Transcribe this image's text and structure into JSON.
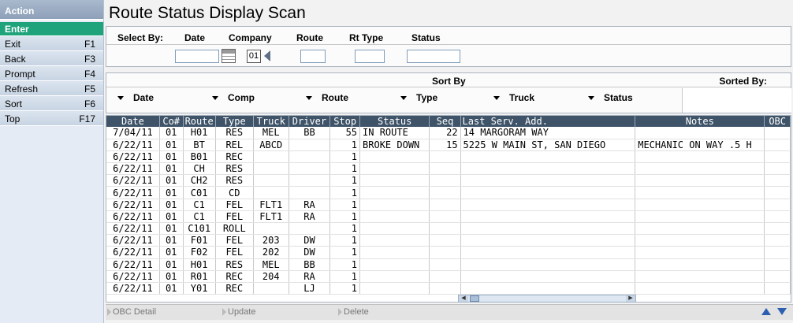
{
  "sidebar": {
    "header": "Action",
    "enter": "Enter",
    "items": [
      {
        "label": "Exit",
        "key": "F1"
      },
      {
        "label": "Back",
        "key": "F3"
      },
      {
        "label": "Prompt",
        "key": "F4"
      },
      {
        "label": "Refresh",
        "key": "F5"
      },
      {
        "label": "Sort",
        "key": "F6"
      },
      {
        "label": "Top",
        "key": "F17"
      }
    ]
  },
  "title": "Route Status Display Scan",
  "select": {
    "label": "Select By:",
    "date": "Date",
    "company": "Company",
    "route": "Route",
    "rttype": "Rt Type",
    "status": "Status",
    "company_value": "01"
  },
  "sort": {
    "title": "Sort By",
    "sorted_by": "Sorted By:",
    "fields": [
      "Date",
      "Comp",
      "Route",
      "Type",
      "Truck",
      "Status"
    ]
  },
  "grid": {
    "columns": [
      "Date",
      "Co#",
      "Route",
      "Type",
      "Truck",
      "Driver",
      "Stop",
      "Status",
      "Seq",
      "Last Serv. Add.",
      "Notes",
      "OBC"
    ],
    "rows": [
      [
        "7/04/11",
        "01",
        "H01",
        "RES",
        "MEL",
        "BB",
        "55",
        "IN ROUTE",
        "22",
        "14 MARGORAM WAY",
        "",
        ""
      ],
      [
        "6/22/11",
        "01",
        "BT",
        "REL",
        "ABCD",
        "",
        "1",
        "BROKE DOWN",
        "15",
        "5225 W MAIN ST, SAN DIEGO",
        "MECHANIC ON WAY .5 H",
        ""
      ],
      [
        "6/22/11",
        "01",
        "B01",
        "REC",
        "",
        "",
        "1",
        "",
        "",
        "",
        "",
        ""
      ],
      [
        "6/22/11",
        "01",
        "CH",
        "RES",
        "",
        "",
        "1",
        "",
        "",
        "",
        "",
        ""
      ],
      [
        "6/22/11",
        "01",
        "CH2",
        "RES",
        "",
        "",
        "1",
        "",
        "",
        "",
        "",
        ""
      ],
      [
        "6/22/11",
        "01",
        "C01",
        "CD",
        "",
        "",
        "1",
        "",
        "",
        "",
        "",
        ""
      ],
      [
        "6/22/11",
        "01",
        "C1",
        "FEL",
        "FLT1",
        "RA",
        "1",
        "",
        "",
        "",
        "",
        ""
      ],
      [
        "6/22/11",
        "01",
        "C1",
        "FEL",
        "FLT1",
        "RA",
        "1",
        "",
        "",
        "",
        "",
        ""
      ],
      [
        "6/22/11",
        "01",
        "C101",
        "ROLL",
        "",
        "",
        "1",
        "",
        "",
        "",
        "",
        ""
      ],
      [
        "6/22/11",
        "01",
        "F01",
        "FEL",
        "203",
        "DW",
        "1",
        "",
        "",
        "",
        "",
        ""
      ],
      [
        "6/22/11",
        "01",
        "F02",
        "FEL",
        "202",
        "DW",
        "1",
        "",
        "",
        "",
        "",
        ""
      ],
      [
        "6/22/11",
        "01",
        "H01",
        "RES",
        "MEL",
        "BB",
        "1",
        "",
        "",
        "",
        "",
        ""
      ],
      [
        "6/22/11",
        "01",
        "R01",
        "REC",
        "204",
        "RA",
        "1",
        "",
        "",
        "",
        "",
        ""
      ],
      [
        "6/22/11",
        "01",
        "Y01",
        "REC",
        "",
        "LJ",
        "1",
        "",
        "",
        "",
        "",
        ""
      ]
    ]
  },
  "footer": {
    "obc_detail": "OBC Detail",
    "update": "Update",
    "delete": "Delete"
  }
}
